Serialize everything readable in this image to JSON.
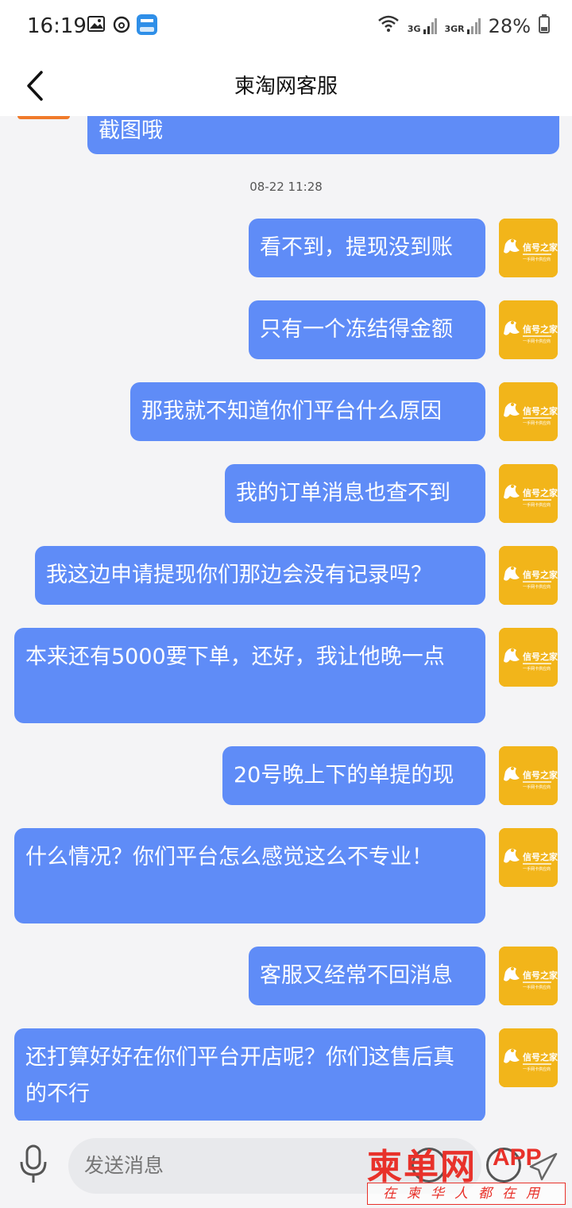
{
  "status_bar": {
    "time": "16:19",
    "net1": "3G",
    "net2": "3GR",
    "battery": "28%"
  },
  "header": {
    "title": "柬淘网客服"
  },
  "chat": {
    "partial_message": "截图哦",
    "timestamp": "08-22 11:28",
    "messages": [
      "看不到，提现没到账",
      "只有一个冻结得金额",
      "那我就不知道你们平台什么原因",
      "我的订单消息也查不到",
      "我这边申请提现你们那边会没有记录吗？",
      "本来还有5000要下单，还好，我让他晚一点",
      "20号晚上下的单提的现",
      "什么情况？你们平台怎么感觉这么不专业！",
      "客服又经常不回消息",
      "还打算好好在你们平台开店呢？你们这售后真的不行"
    ],
    "avatar_label": "信号之家",
    "avatar_sublabel": "一手网卡供应商"
  },
  "input_bar": {
    "placeholder": "发送消息"
  },
  "watermark": {
    "brand": "柬单网",
    "suffix": "APP",
    "slogan": "在柬华人都在用"
  },
  "colors": {
    "bubble": "#5f8cf7",
    "avatar_bg": "#f2b51a",
    "watermark": "#e8312a"
  }
}
